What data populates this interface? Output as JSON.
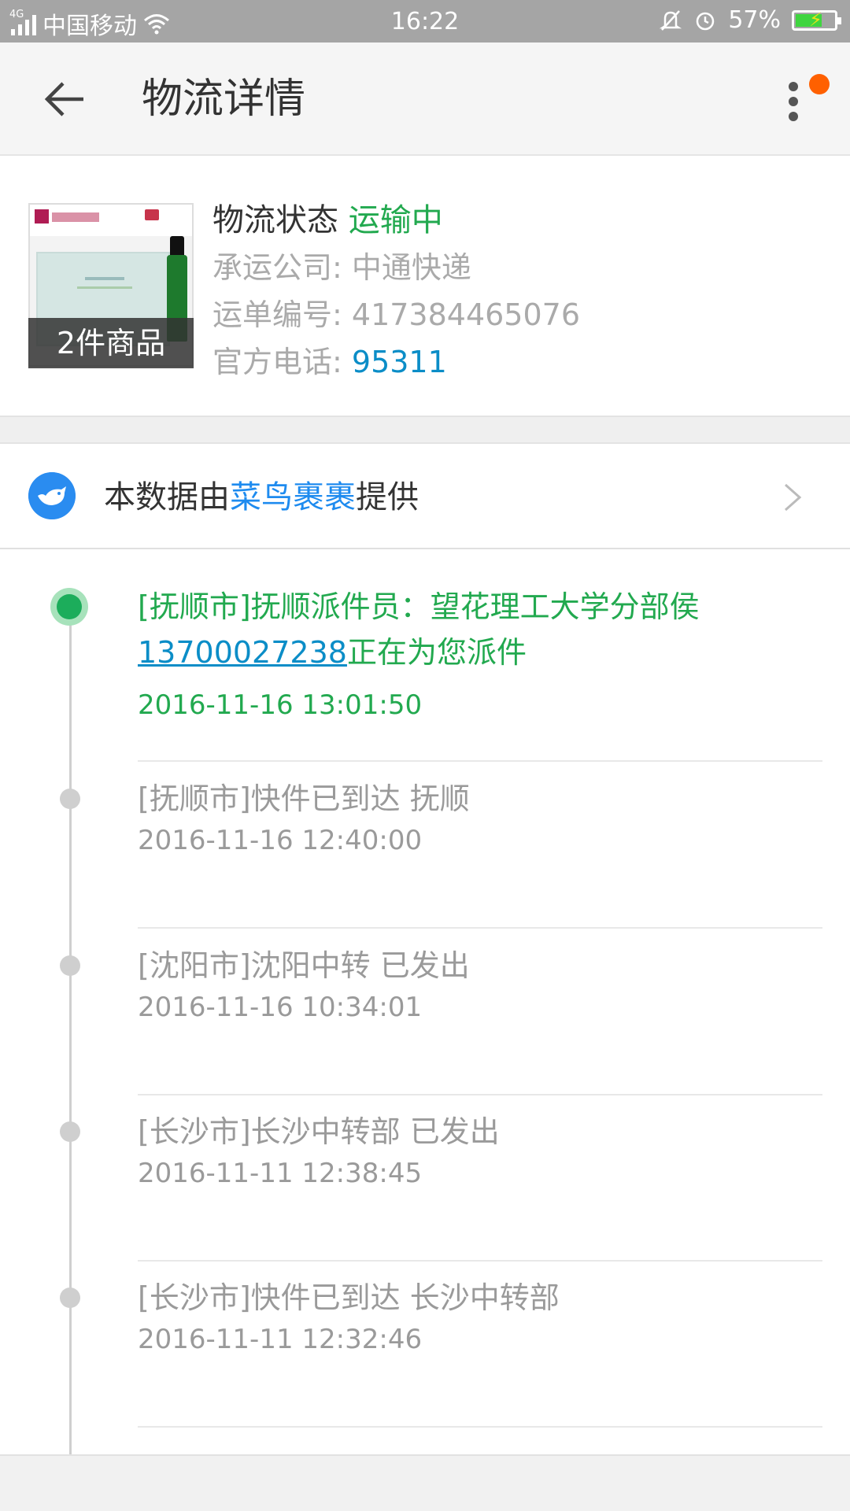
{
  "status_bar": {
    "network": "4G",
    "carrier": "中国移动",
    "time": "16:22",
    "battery": "57%"
  },
  "app_bar": {
    "title": "物流详情"
  },
  "package": {
    "item_count": "2件商品",
    "status_label": "物流状态",
    "status_value": "运输中",
    "carrier_label": "承运公司: ",
    "carrier_value": "中通快递",
    "waybill_label": "运单编号: ",
    "waybill_value": "417384465076",
    "phone_label": "官方电话: ",
    "phone_value": "95311"
  },
  "source": {
    "prefix": "本数据由",
    "provider": "菜鸟裹裹",
    "suffix": "提供"
  },
  "events": [
    {
      "text_before": "[抚顺市]抚顺派件员：望花理工大学分部侯",
      "phone": "13700027238",
      "text_after": "正在为您派件",
      "time": "2016-11-16 13:01:50"
    },
    {
      "text": "[抚顺市]快件已到达 抚顺",
      "time": "2016-11-16 12:40:00"
    },
    {
      "text": "[沈阳市]沈阳中转 已发出",
      "time": "2016-11-16 10:34:01"
    },
    {
      "text": "[长沙市]长沙中转部 已发出",
      "time": "2016-11-11 12:38:45"
    },
    {
      "text": "[长沙市]快件已到达 长沙中转部",
      "time": "2016-11-11 12:32:46"
    }
  ],
  "colors": {
    "active_green": "#22a94f",
    "link_blue": "#0b8dc7",
    "accent_orange": "#ff6000"
  }
}
